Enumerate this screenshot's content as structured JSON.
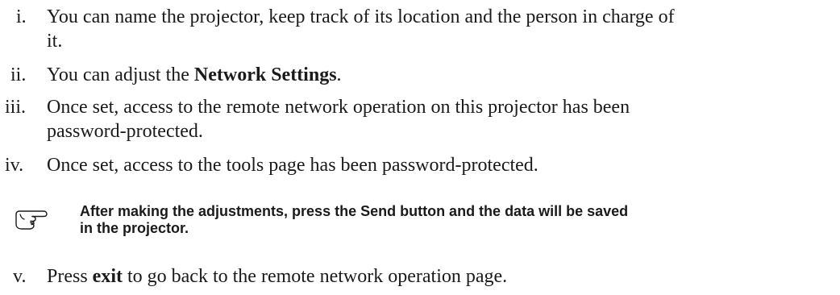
{
  "items": [
    {
      "num": "i.",
      "line1": "You can name the projector, keep track of its location and the person in charge of",
      "line2": "it."
    },
    {
      "num": "ii.",
      "pre": "You can adjust the ",
      "bold": "Network Settings",
      "post": "."
    },
    {
      "num": "iii.",
      "line1": "Once set, access to the remote network operation on this projector has been",
      "line2": "password-protected."
    },
    {
      "num": "iv.",
      "line1": "Once set, access to the tools page has been password-protected."
    },
    {
      "num": "v.",
      "pre": "Press ",
      "bold": "exit",
      "post": " to go back to the remote network operation page."
    }
  ],
  "note": {
    "icon": "pointing-hand-icon",
    "line1": "After making the adjustments, press the Send button and the data will be saved",
    "line2": "in the projector."
  }
}
